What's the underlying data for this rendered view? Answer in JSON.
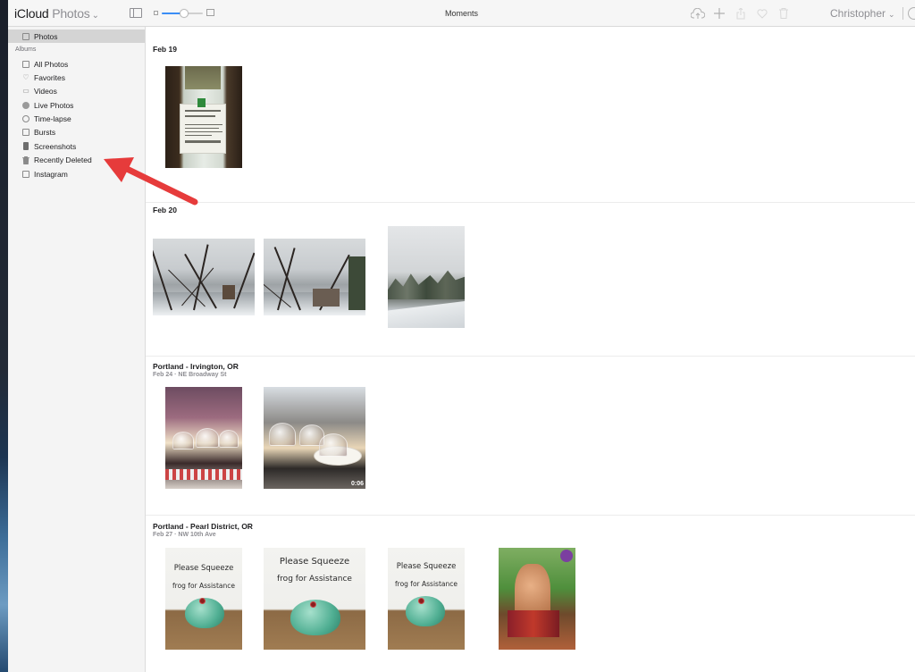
{
  "app": {
    "brand_main": "iCloud",
    "brand_sub": "Photos",
    "view_title": "Moments"
  },
  "toolbar": {
    "icons": [
      "upload-icon",
      "add-icon",
      "share-icon",
      "favorite-icon",
      "trash-icon"
    ],
    "user_name": "Christopher",
    "zoom_level": 0.55
  },
  "sidebar": {
    "photos_label": "Photos",
    "albums_header": "Albums",
    "items": [
      {
        "label": "All Photos",
        "icon": "album-icon"
      },
      {
        "label": "Favorites",
        "icon": "heart-icon"
      },
      {
        "label": "Videos",
        "icon": "video-icon"
      },
      {
        "label": "Live Photos",
        "icon": "live-photo-icon"
      },
      {
        "label": "Time-lapse",
        "icon": "time-lapse-icon"
      },
      {
        "label": "Bursts",
        "icon": "bursts-icon"
      },
      {
        "label": "Screenshots",
        "icon": "screenshot-icon"
      },
      {
        "label": "Recently Deleted",
        "icon": "trash-icon"
      },
      {
        "label": "Instagram",
        "icon": "album-icon"
      }
    ]
  },
  "moments": [
    {
      "title": "Feb 19",
      "subtitle": "",
      "photos": [
        {
          "alt": "bottle"
        }
      ]
    },
    {
      "title": "Feb 20",
      "subtitle": "",
      "photos": [
        {
          "alt": "snowy-trees-1"
        },
        {
          "alt": "snowy-trees-2"
        },
        {
          "alt": "snowy-rooftop"
        }
      ]
    },
    {
      "title": "Portland - Irvington, OR",
      "subtitle": "Feb 24  ·  NE Broadway St",
      "photos": [
        {
          "alt": "sushi-1"
        },
        {
          "alt": "sushi-2",
          "badge": "0:06"
        }
      ]
    },
    {
      "title": "Portland - Pearl District, OR",
      "subtitle": "Feb 27  ·  NW 10th Ave",
      "photos": [
        {
          "alt": "frog-sign-1"
        },
        {
          "alt": "frog-sign-2"
        },
        {
          "alt": "frog-sign-3"
        },
        {
          "alt": "book-cover"
        }
      ]
    }
  ],
  "sign_text": {
    "line1": "Please Squeeze",
    "line2": "frog for Assistance"
  },
  "colors": {
    "accent": "#3a8ef6",
    "arrow": "#e63b3b",
    "selected": "#d4d4d4"
  }
}
